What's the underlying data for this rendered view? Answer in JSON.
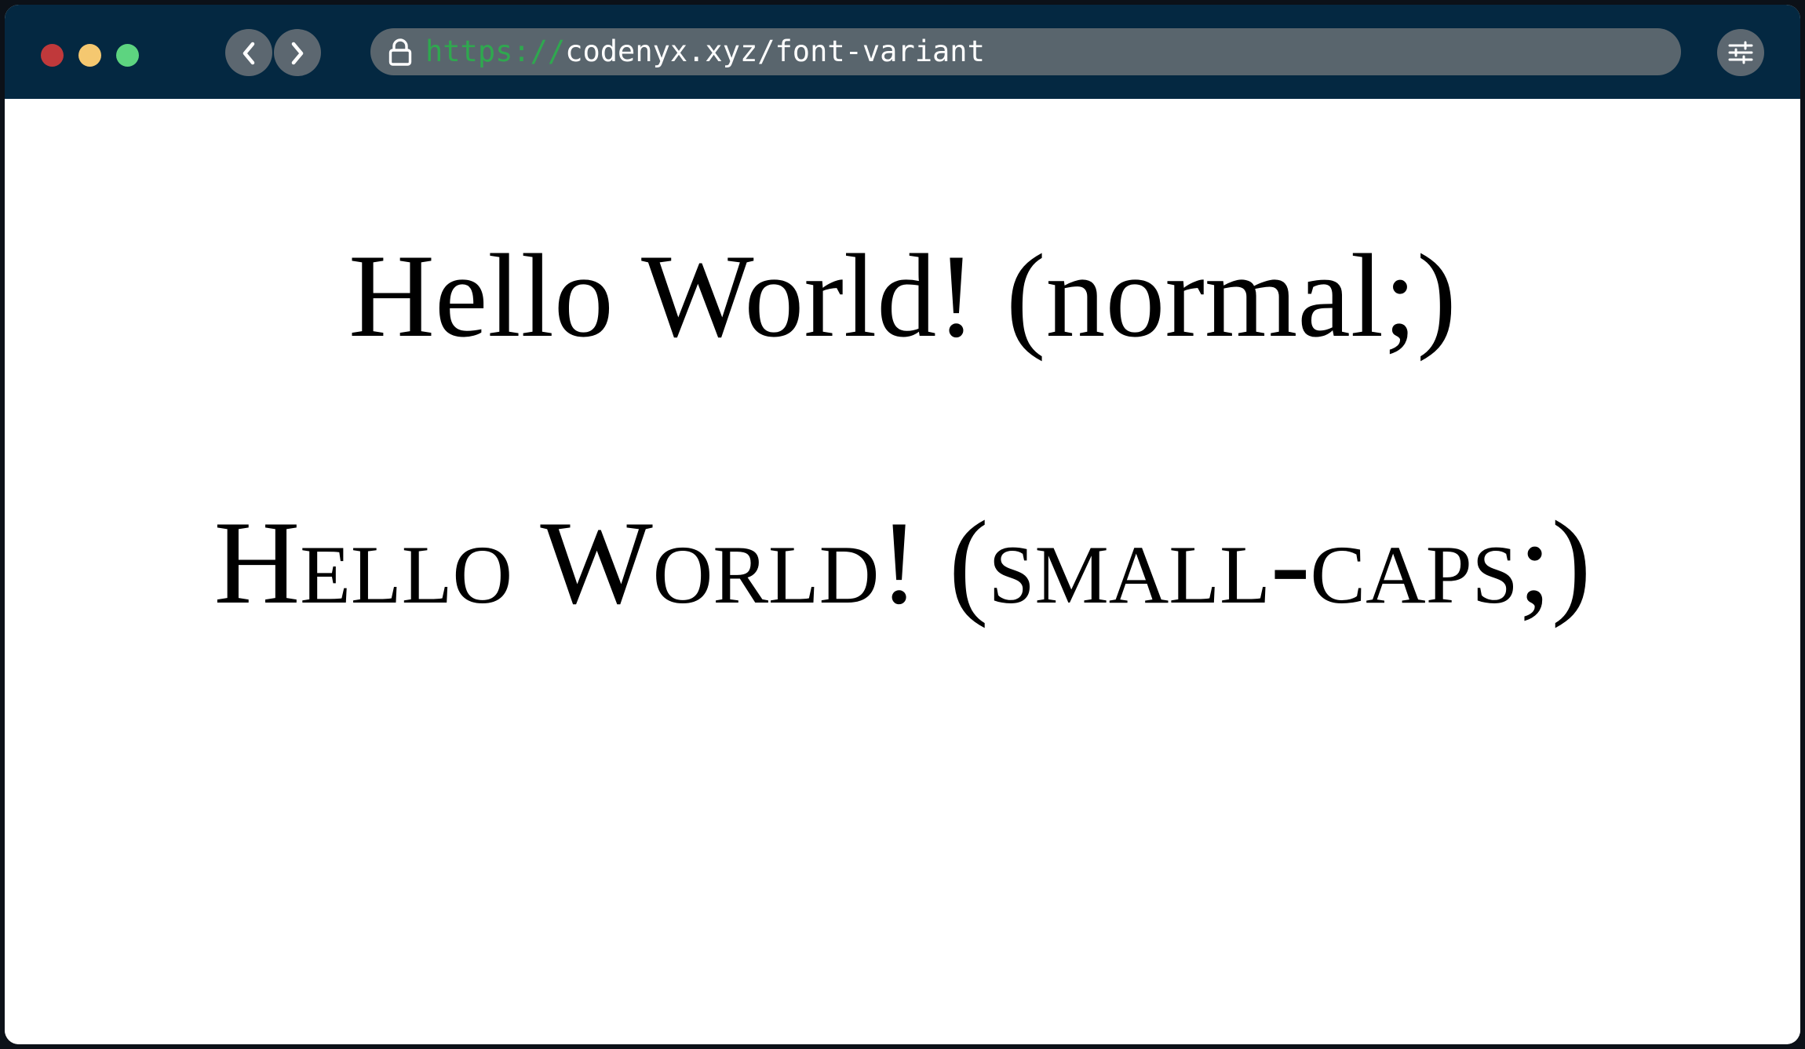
{
  "browser": {
    "url_scheme": "https://",
    "url_rest": "codenyx.xyz/font-variant",
    "titlebar_color": "#042841",
    "traffic_lights": {
      "close_color": "#c0393b",
      "minimize_color": "#f5c870",
      "maximize_color": "#5dd480"
    },
    "icons": {
      "back": "chevron-left-icon",
      "forward": "chevron-right-icon",
      "lock": "lock-icon",
      "settings": "sliders-icon"
    }
  },
  "page": {
    "line_normal": "Hello World! (normal;)",
    "line_small_caps": "Hello World! (small-caps;)"
  }
}
